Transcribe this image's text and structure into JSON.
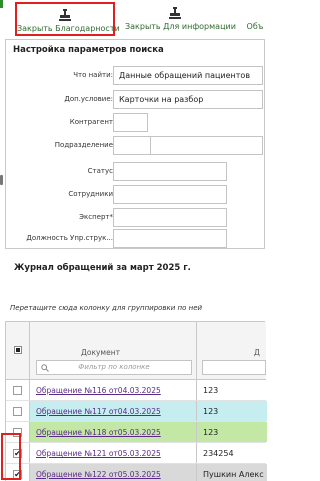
{
  "toolbar": {
    "buttons": [
      {
        "label": "Закрыть Благодарности",
        "icon": "stamp-icon"
      },
      {
        "label": "Закрыть Для информации",
        "icon": "stamp-icon"
      },
      {
        "label": "Объ",
        "icon": ""
      }
    ]
  },
  "search": {
    "title": "Настройка параметров поиска",
    "fields": [
      {
        "label": "Что найти:",
        "value": "Данные обращений пациентов"
      },
      {
        "label": "Доп.условие:",
        "value": "Карточки на разбор"
      },
      {
        "label": "Контрагент",
        "value": ""
      },
      {
        "label": "Подразделение",
        "value": ""
      },
      {
        "label": "Статус",
        "value": ""
      },
      {
        "label": "Сотрудники",
        "value": ""
      },
      {
        "label": "Эксперт*",
        "value": ""
      },
      {
        "label": "Должность Упр.струк...",
        "value": ""
      }
    ]
  },
  "journal": {
    "title": "Журнал обращений за март 2025 г.",
    "group_hint": "Перетащите сюда колонку для группировки по ней",
    "columns": {
      "doc": "Документ",
      "second": "Д"
    },
    "filter_placeholder": "Фильтр по колонке",
    "rows": [
      {
        "doc": "Обращение №116 от04.03.2025",
        "val": "123",
        "checked": false,
        "bg": "#ffffff"
      },
      {
        "doc": "Обращение №117 от04.03.2025",
        "val": "123",
        "checked": false,
        "bg": "#c6eef0"
      },
      {
        "doc": "Обращение №118 от05.03.2025",
        "val": "123",
        "checked": false,
        "bg": "#c3e8a6"
      },
      {
        "doc": "Обращение №121 от05.03.2025",
        "val": "234254",
        "checked": true,
        "bg": "#ffffff"
      },
      {
        "doc": "Обращение №122 от05.03.2025",
        "val": "Пушкин Алекс",
        "checked": true,
        "bg": "#d9d9d9"
      }
    ]
  },
  "colors": {
    "accent_green": "#2f6b2f",
    "highlight_red": "#e0201f",
    "link_purple": "#5b2a86"
  }
}
